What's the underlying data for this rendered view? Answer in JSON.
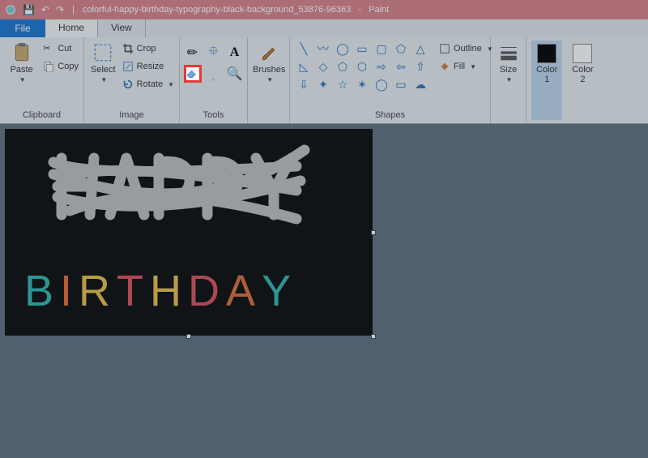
{
  "title": {
    "filename": "colorful-happy-birthday-typography-black-background_53876-96363",
    "app": "Paint"
  },
  "tabs": {
    "file": "File",
    "home": "Home",
    "view": "View"
  },
  "groups": {
    "clipboard": {
      "label": "Clipboard",
      "paste": "Paste",
      "cut": "Cut",
      "copy": "Copy"
    },
    "image": {
      "label": "Image",
      "select": "Select",
      "crop": "Crop",
      "resize": "Resize",
      "rotate": "Rotate"
    },
    "tools": {
      "label": "Tools"
    },
    "brushes": {
      "label": "",
      "brushes": "Brushes"
    },
    "shapes": {
      "label": "Shapes",
      "outline": "Outline",
      "fill": "Fill"
    },
    "size": {
      "label": "",
      "size": "Size"
    },
    "colors": {
      "label": "",
      "color1": "Color\n1",
      "color2": "Color\n2"
    }
  },
  "canvas": {
    "scribble_color": "#bfbfbf",
    "text": "BIRTHDAY"
  },
  "colors": {
    "primary": "#000000",
    "secondary": "#ffffff"
  }
}
